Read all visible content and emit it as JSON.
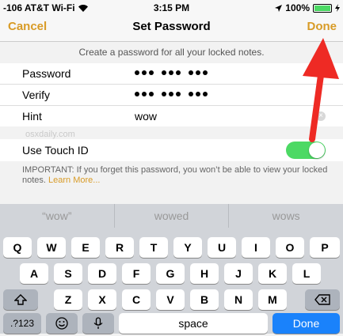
{
  "status_bar": {
    "carrier": "-106 AT&T Wi-Fi",
    "time": "3:15 PM",
    "battery": "100%",
    "battery_level": 1.0,
    "icons": [
      "wifi-icon",
      "location-arrow-icon",
      "battery-icon",
      "charging-bolt-icon"
    ]
  },
  "nav": {
    "cancel": "Cancel",
    "title": "Set Password",
    "done": "Done"
  },
  "description": "Create a password for all your locked notes.",
  "form": {
    "password_label": "Password",
    "verify_label": "Verify",
    "hint_label": "Hint",
    "hint_value": "wow",
    "password_dots": 9,
    "verify_dots": 9
  },
  "watermark": "osxdaily.com",
  "touch_id": {
    "label": "Use Touch ID",
    "enabled": true
  },
  "important": {
    "text": "IMPORTANT: If you forget this password, you won’t be able to view your locked notes.",
    "link": "Learn More..."
  },
  "suggestions": [
    "“wow”",
    "wowed",
    "wows"
  ],
  "keyboard": {
    "row1": [
      "Q",
      "W",
      "E",
      "R",
      "T",
      "Y",
      "U",
      "I",
      "O",
      "P"
    ],
    "row2": [
      "A",
      "S",
      "D",
      "F",
      "G",
      "H",
      "J",
      "K",
      "L"
    ],
    "row3": [
      "Z",
      "X",
      "C",
      "V",
      "B",
      "N",
      "M"
    ],
    "numbers": ".?123",
    "space": "space",
    "done": "Done"
  },
  "colors": {
    "accent": "#d89b26",
    "toggle_on": "#4cd964",
    "done_key": "#1a82fb",
    "arrow": "#ee2a24"
  }
}
